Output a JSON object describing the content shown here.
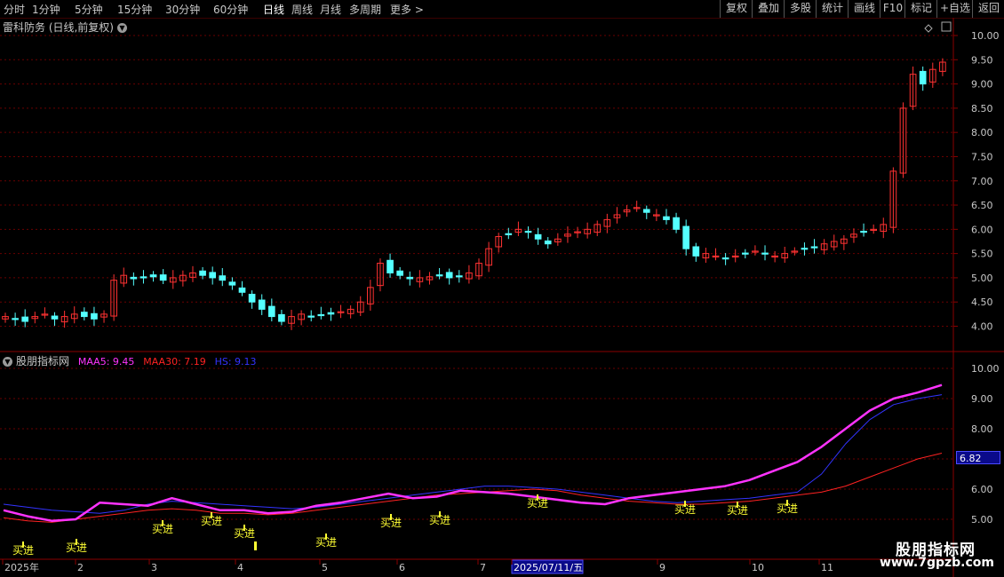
{
  "toolbar": {
    "periods": [
      "分时",
      "1分钟",
      "5分钟",
      "15分钟",
      "30分钟",
      "60分钟",
      "日线",
      "周线",
      "月线",
      "多周期",
      "更多 >"
    ],
    "active": "日线",
    "right_buttons": [
      "复权",
      "叠加",
      "多股",
      "统计",
      "画线",
      "F10",
      "标记",
      "+自选",
      "返回"
    ]
  },
  "main_panel": {
    "title": "雷科防务 (日线,前复权)",
    "y_ticks": [
      "10.00",
      "9.50",
      "9.00",
      "8.50",
      "8.00",
      "7.50",
      "7.00",
      "6.50",
      "6.00",
      "5.50",
      "5.00",
      "4.50",
      "4.00"
    ]
  },
  "indicator_panel": {
    "name": "股朋指标网",
    "maa5_label": "MAA5: 9.45",
    "maa30_label": "MAA30: 7.19",
    "hs_label": "HS: 9.13",
    "y_ticks": [
      "10.00",
      "9.00",
      "8.00",
      "7.00",
      "6.00",
      "5.00"
    ],
    "current_value": "6.82",
    "signal_label": "买进"
  },
  "x_axis": {
    "labels": [
      "2025年",
      "2",
      "3",
      "4",
      "5",
      "6",
      "7",
      "2025/07/11/五",
      "9",
      "10",
      "11"
    ]
  },
  "watermark": {
    "name": "股朋指标网",
    "url": "www.7gpzb.com"
  },
  "colors": {
    "up": "#ff3232",
    "down": "#54ffff",
    "maa5": "#ff33ff",
    "maa30": "#ff2222",
    "hs": "#3333ff",
    "signal": "#ffff33",
    "grid": "#6a0000"
  },
  "chart_data": {
    "type": "candlestick",
    "price_series": [
      4.2,
      4.15,
      4.1,
      4.2,
      4.25,
      4.15,
      4.2,
      4.25,
      4.2,
      4.15,
      4.25,
      4.95,
      5.05,
      4.98,
      5.0,
      5.02,
      4.95,
      5.0,
      5.05,
      5.1,
      5.05,
      5.0,
      4.95,
      4.85,
      4.7,
      4.5,
      4.35,
      4.2,
      4.1,
      4.2,
      4.25,
      4.2,
      4.22,
      4.25,
      4.3,
      4.35,
      4.5,
      4.8,
      5.3,
      5.1,
      5.05,
      4.98,
      5.0,
      5.02,
      5.05,
      5.0,
      5.02,
      5.1,
      5.3,
      5.6,
      5.85,
      5.9,
      6.0,
      5.95,
      5.8,
      5.7,
      5.8,
      5.9,
      5.95,
      6.0,
      6.1,
      6.2,
      6.3,
      6.4,
      6.45,
      6.35,
      6.3,
      6.2,
      6.0,
      5.6,
      5.45,
      5.5,
      5.45,
      5.4,
      5.45,
      5.5,
      5.55,
      5.5,
      5.45,
      5.5,
      5.55,
      5.6,
      5.62,
      5.7,
      5.75,
      5.8,
      5.9,
      5.95,
      6.0,
      6.1,
      7.2,
      8.5,
      9.2,
      9.0,
      9.3,
      9.45
    ],
    "maa5": [
      5.3,
      5.1,
      4.95,
      5.0,
      5.55,
      5.5,
      5.45,
      5.7,
      5.5,
      5.3,
      5.3,
      5.2,
      5.25,
      5.45,
      5.55,
      5.7,
      5.85,
      5.7,
      5.75,
      5.95,
      5.9,
      5.85,
      5.75,
      5.65,
      5.55,
      5.5,
      5.7,
      5.8,
      5.9,
      6.0,
      6.1,
      6.3,
      6.6,
      6.9,
      7.4,
      8.0,
      8.6,
      9.0,
      9.2,
      9.45
    ],
    "maa30": [
      5.05,
      4.95,
      4.9,
      5.0,
      5.1,
      5.2,
      5.3,
      5.35,
      5.3,
      5.2,
      5.2,
      5.15,
      5.2,
      5.3,
      5.4,
      5.5,
      5.6,
      5.7,
      5.8,
      5.85,
      5.9,
      5.95,
      6.0,
      5.95,
      5.8,
      5.7,
      5.6,
      5.55,
      5.5,
      5.5,
      5.55,
      5.6,
      5.7,
      5.8,
      5.9,
      6.1,
      6.4,
      6.7,
      7.0,
      7.19
    ],
    "hs": [
      5.5,
      5.4,
      5.3,
      5.25,
      5.2,
      5.3,
      5.5,
      5.6,
      5.55,
      5.5,
      5.45,
      5.4,
      5.35,
      5.4,
      5.5,
      5.6,
      5.7,
      5.8,
      5.9,
      6.0,
      6.1,
      6.1,
      6.05,
      6.0,
      5.9,
      5.8,
      5.7,
      5.6,
      5.55,
      5.6,
      5.65,
      5.7,
      5.8,
      5.9,
      6.5,
      7.5,
      8.3,
      8.8,
      9.0,
      9.13
    ],
    "buy_signals": 13,
    "title": "雷科防务 (日线,前复权)",
    "ylim_main": [
      3.8,
      10.2
    ],
    "ylim_indicator": [
      4.6,
      10.2
    ],
    "grid": true
  }
}
